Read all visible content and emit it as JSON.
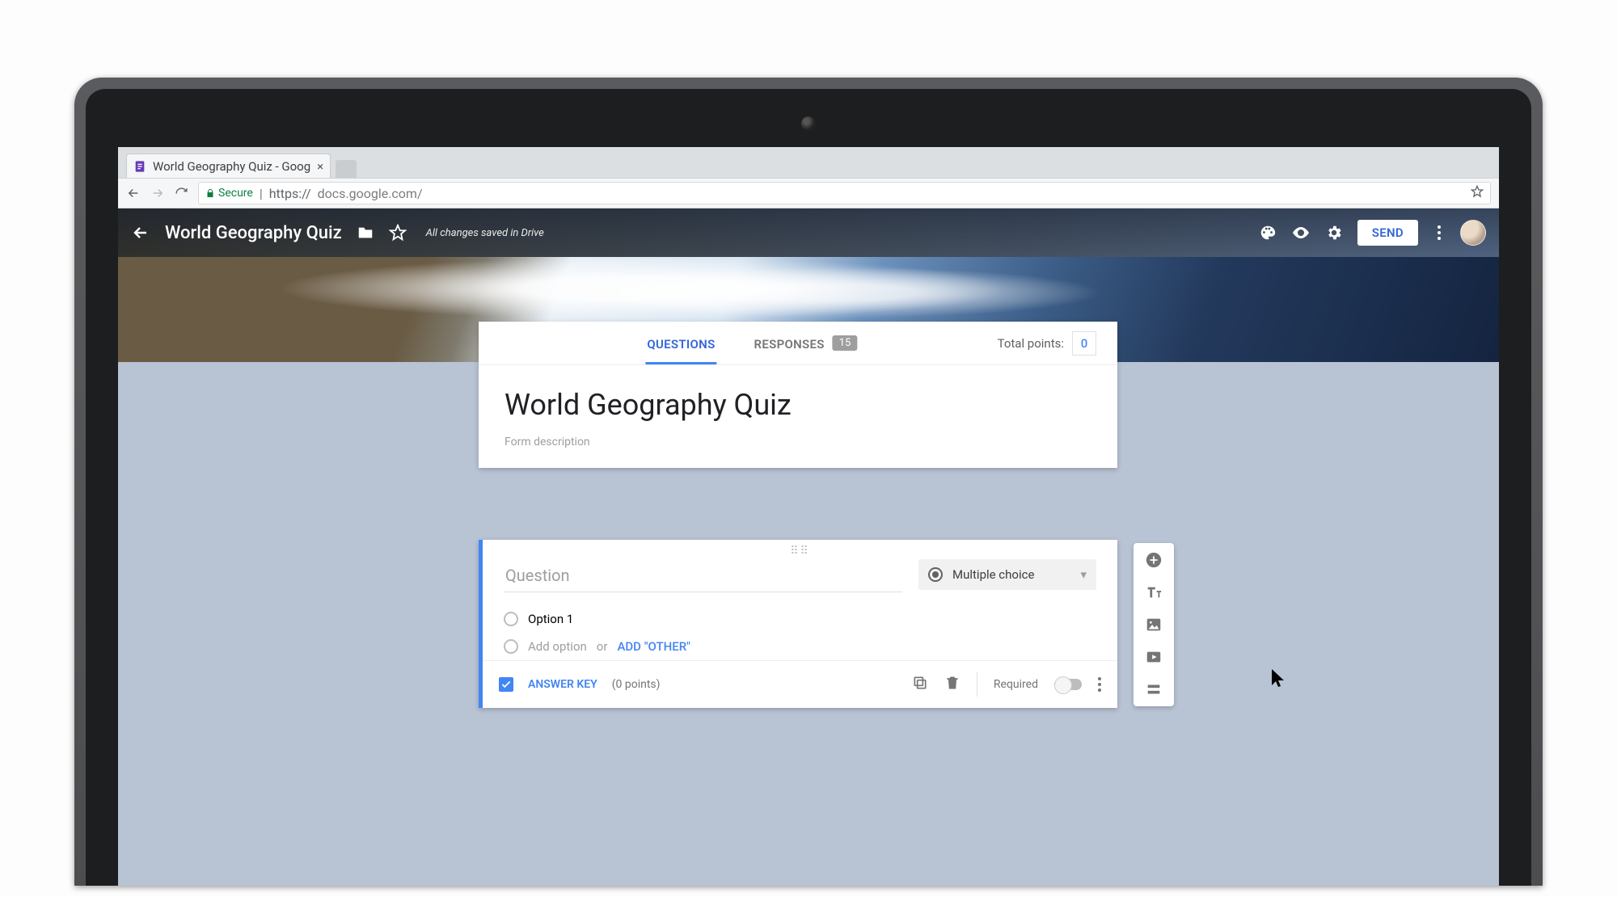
{
  "browser": {
    "tab_title": "World Geography Quiz - Goog",
    "secure_label": "Secure",
    "url_prefix": "https://",
    "url_rest": "docs.google.com/"
  },
  "header": {
    "title": "World Geography Quiz",
    "save_msg": "All changes saved in Drive",
    "send_label": "SEND"
  },
  "tabs": {
    "questions": "QUESTIONS",
    "responses": "RESPONSES",
    "responses_count": "15",
    "total_points_label": "Total points:",
    "total_points_value": "0"
  },
  "form": {
    "title": "World Geography Quiz",
    "desc_placeholder": "Form description"
  },
  "question": {
    "placeholder": "Question",
    "type_label": "Multiple choice",
    "option1": "Option 1",
    "add_option": "Add option",
    "or_label": "or",
    "add_other": "ADD \"OTHER\"",
    "answer_key": "ANSWER KEY",
    "points_text": "(0 points)",
    "required_label": "Required"
  }
}
